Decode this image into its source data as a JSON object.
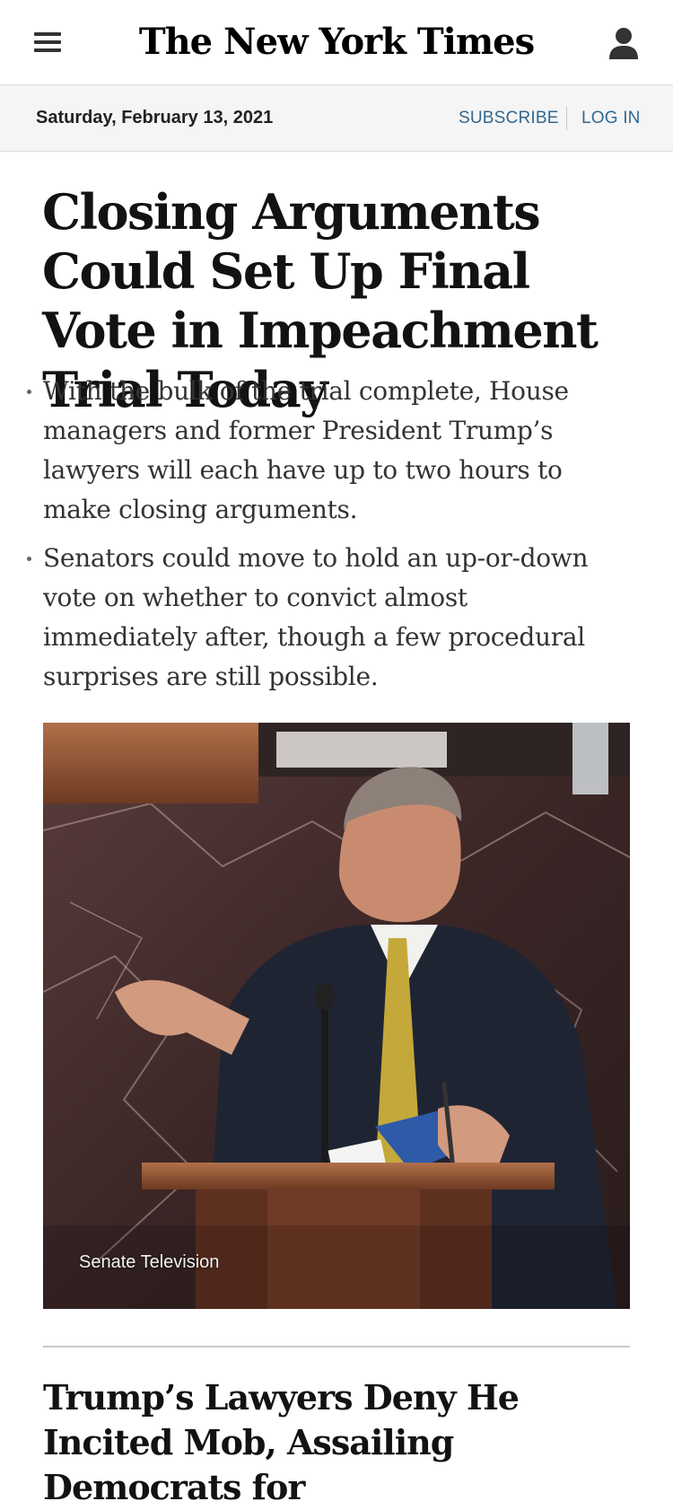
{
  "masthead": {
    "menu_icon": "hamburger-menu-icon",
    "logo": "The New York Times",
    "account_icon": "person-icon"
  },
  "subbar": {
    "date": "Saturday, February 13, 2021",
    "subscribe": "SUBSCRIBE",
    "login": "LOG IN"
  },
  "article": {
    "headline": "Closing Arguments Could Set Up Final Vote in Impeachment Trial Today",
    "summary": [
      "With the bulk of the trial complete, House managers and former President Trump’s lawyers will each have up to two hours to make closing arguments.",
      "Senators could move to hold an up-or-down vote on whether to convict almost immediately after, though a few procedural surprises are still possible."
    ],
    "photo_credit": "Senate Television"
  },
  "next_article": {
    "headline": "Trump’s Lawyers Deny He Incited Mob, Assailing Democrats for"
  },
  "colors": {
    "link": "#326891",
    "subbar_bg": "#f5f5f5",
    "text": "#121212"
  }
}
